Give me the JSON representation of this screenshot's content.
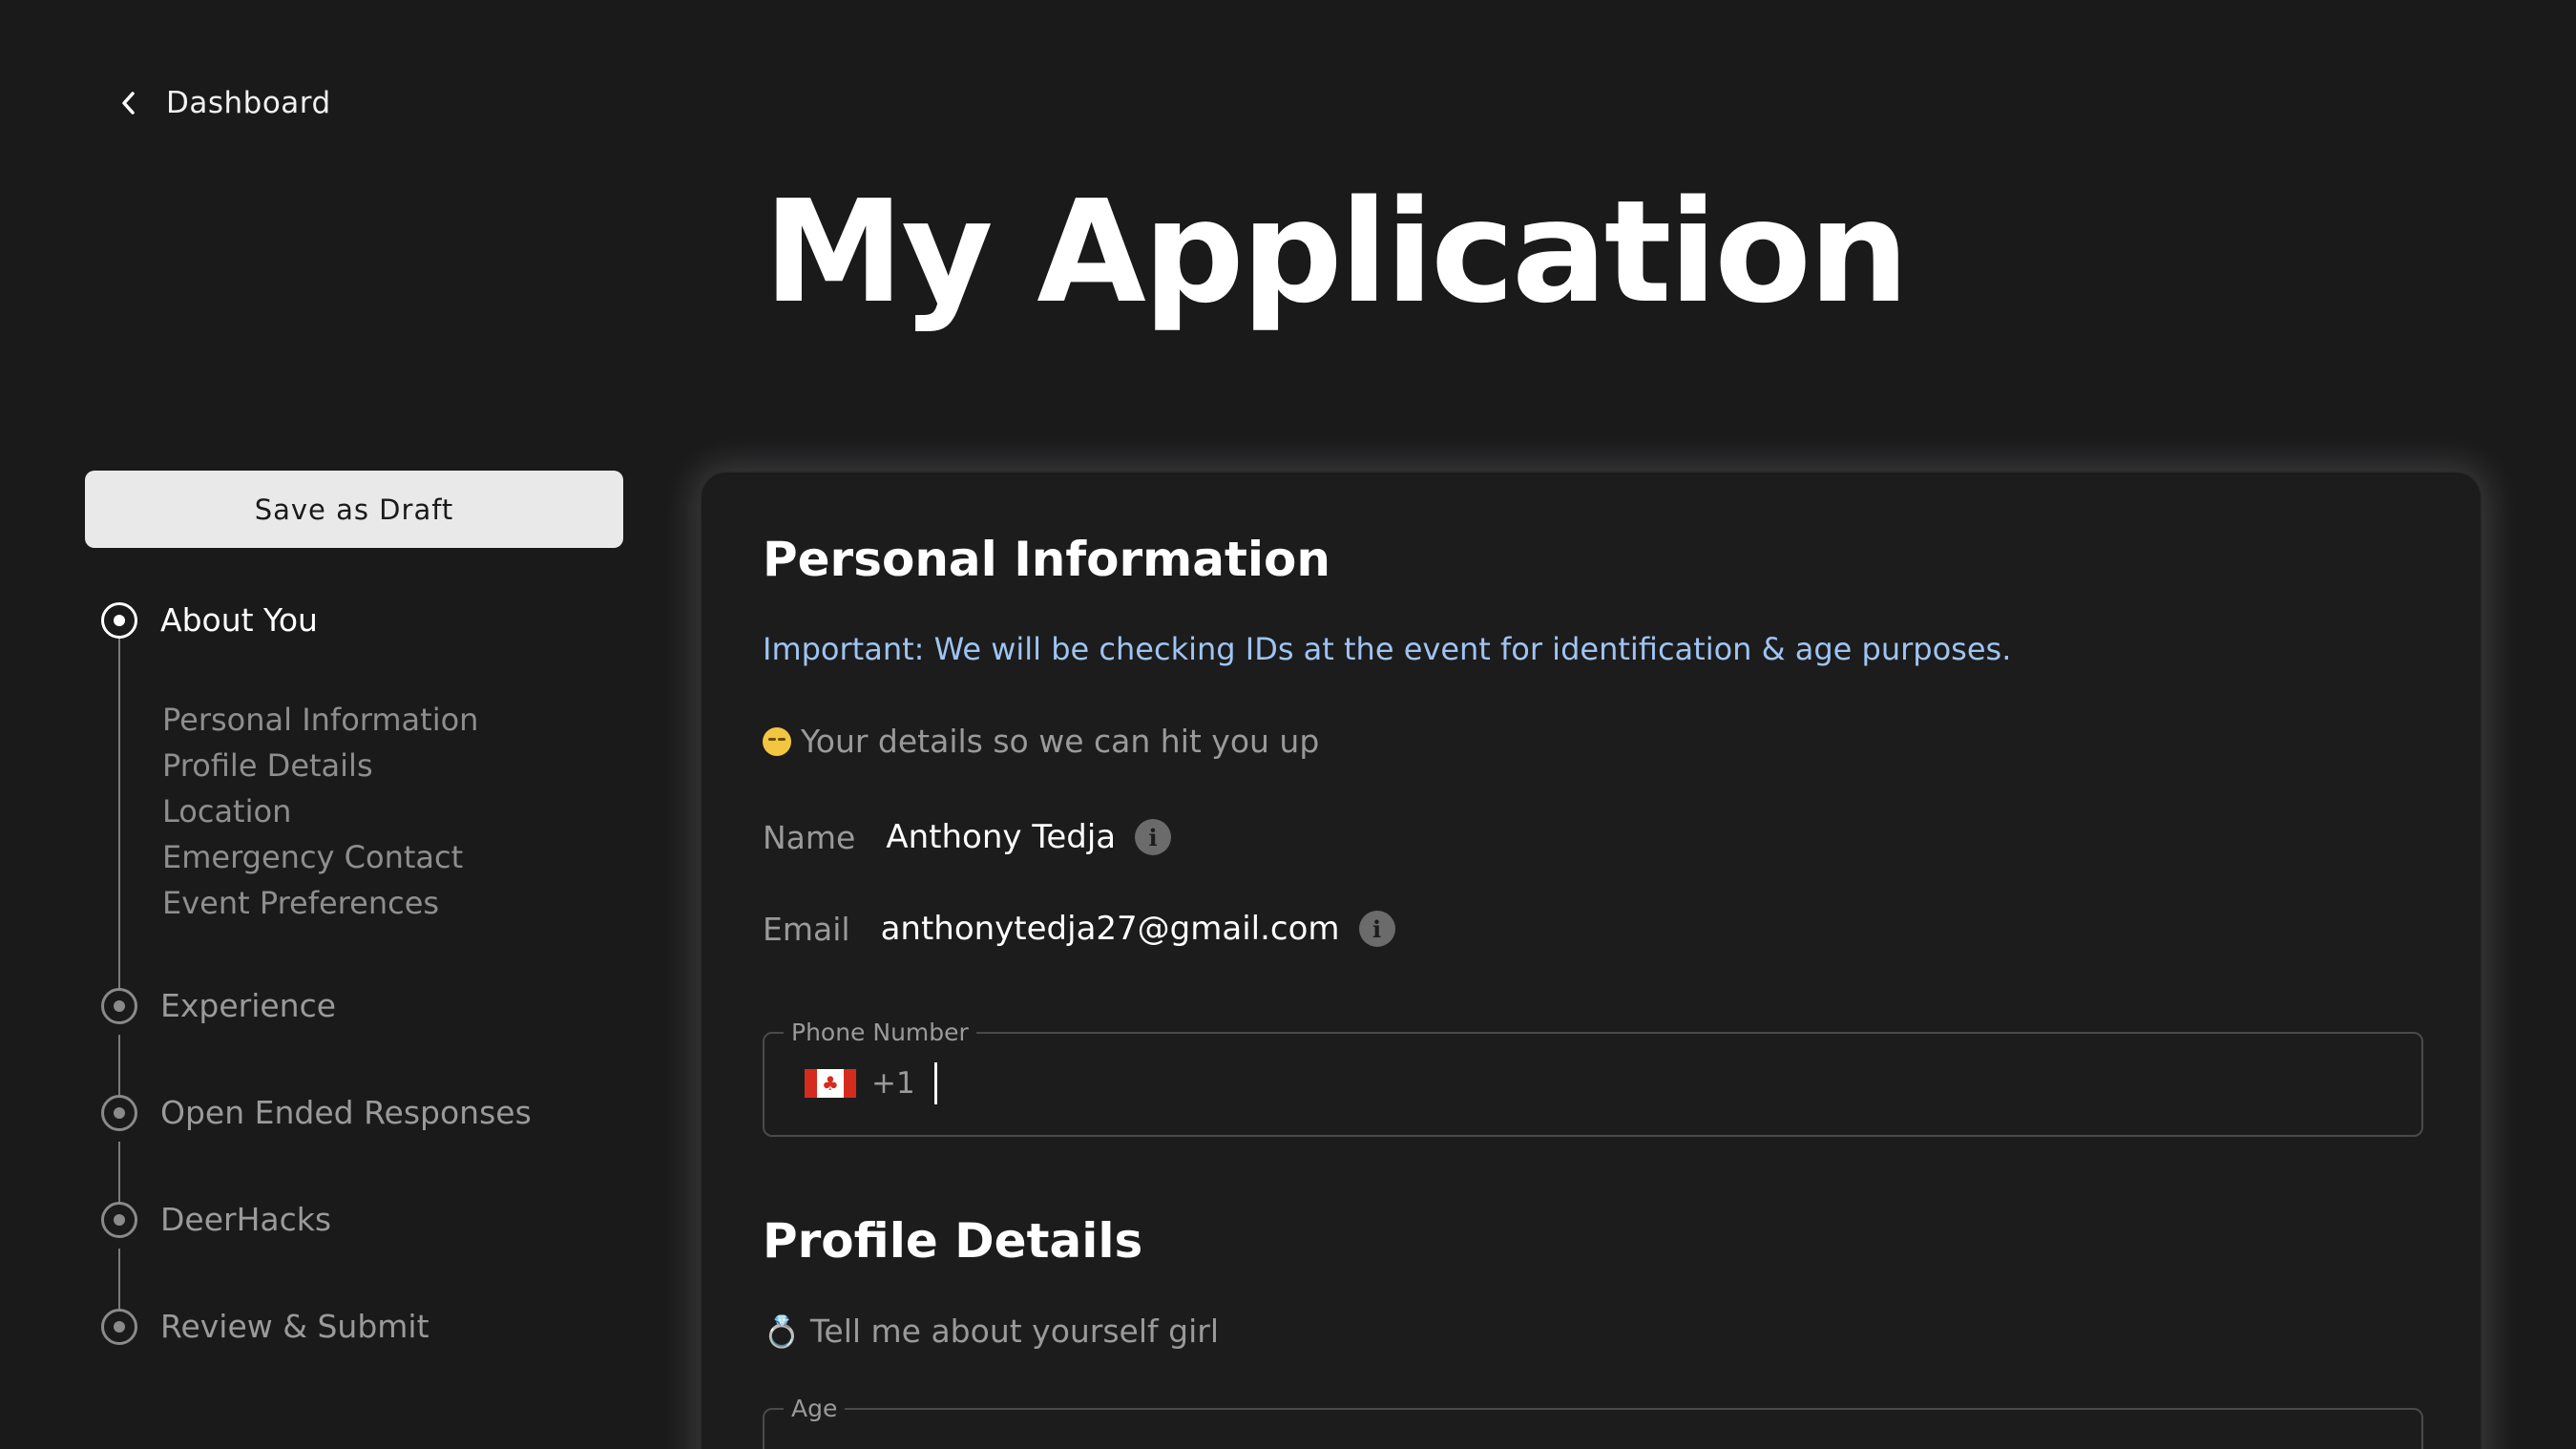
{
  "nav": {
    "back_label": "Dashboard"
  },
  "page": {
    "title": "My Application"
  },
  "sidebar": {
    "save_label": "Save as Draft",
    "steps": [
      {
        "label": "About You",
        "active": true
      },
      {
        "label": "Experience",
        "active": false
      },
      {
        "label": "Open Ended Responses",
        "active": false
      },
      {
        "label": "DeerHacks",
        "active": false
      },
      {
        "label": "Review & Submit",
        "active": false
      }
    ],
    "substeps": [
      "Personal Information",
      "Profile Details",
      "Location",
      "Emergency Contact",
      "Event Preferences"
    ]
  },
  "form": {
    "personal": {
      "title": "Personal Information",
      "notice": "Important: We will be checking IDs at the event for identification & age purposes.",
      "subtitle": "Your details so we can hit you up",
      "subtitle_icon": "smirk-emoji-icon",
      "name_label": "Name",
      "name_value": "Anthony Tedja",
      "email_label": "Email",
      "email_value": "anthonytedja27@gmail.com",
      "phone_label": "Phone Number",
      "phone_country": "canada-flag-icon",
      "phone_dial": "+1",
      "phone_value": ""
    },
    "profile": {
      "title": "Profile Details",
      "subtitle": "Tell me about yourself girl",
      "subtitle_icon": "ring-icon",
      "age_label": "Age",
      "age_value": ""
    }
  },
  "colors": {
    "background": "#1a1a1b",
    "notice": "#9fc4f2",
    "accent_white": "#ffffff",
    "muted": "#9a9a9a"
  }
}
